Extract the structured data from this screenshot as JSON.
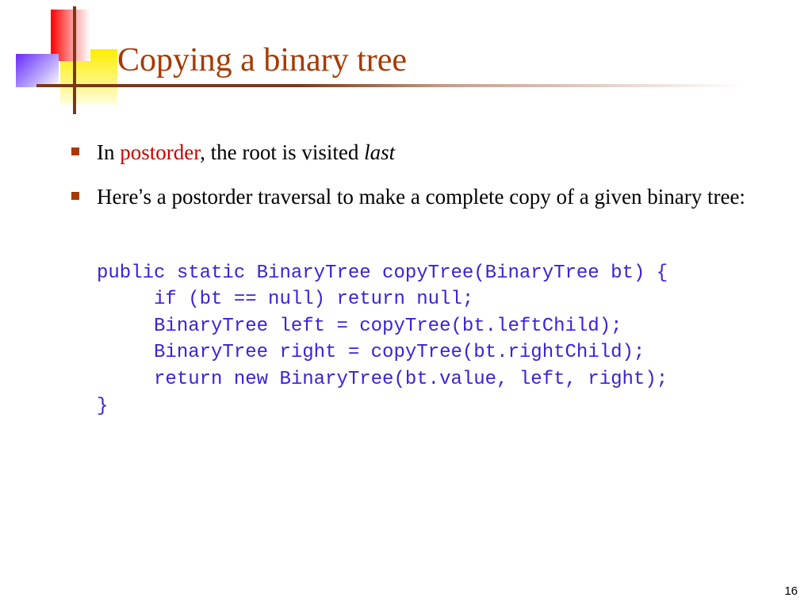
{
  "title": "Copying a binary tree",
  "bullets": [
    {
      "pre": "In ",
      "red": "postorder",
      "mid": ", the root is visited ",
      "ital": "last"
    },
    {
      "pre": "Here",
      "apos": "’",
      "rest": "s a postorder traversal to make a complete copy of a given binary tree:"
    }
  ],
  "code": "public static BinaryTree copyTree(BinaryTree bt) {\n     if (bt == null) return null;\n     BinaryTree left = copyTree(bt.leftChild);\n     BinaryTree right = copyTree(bt.rightChild);\n     return new BinaryTree(bt.value, left, right);\n}",
  "page_number": "16"
}
